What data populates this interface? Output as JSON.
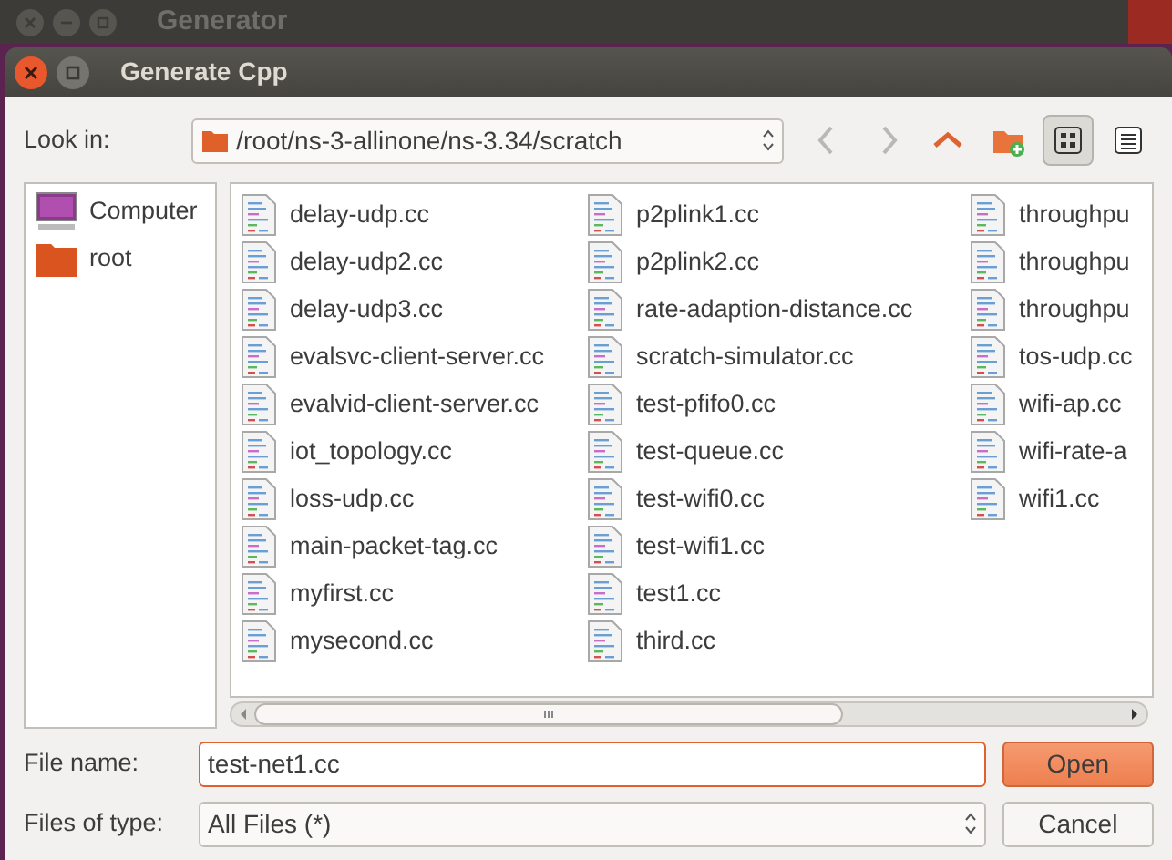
{
  "background_window": {
    "title": "Generator"
  },
  "dialog": {
    "title": "Generate Cpp"
  },
  "look_in": {
    "label": "Look in:",
    "path": "/root/ns-3-allinone/ns-3.34/scratch"
  },
  "toolbar": [
    {
      "kind": "back",
      "disabled": true
    },
    {
      "kind": "forward",
      "disabled": true
    },
    {
      "kind": "up",
      "disabled": false
    },
    {
      "kind": "new-folder",
      "disabled": false
    },
    {
      "kind": "icon-view",
      "selected": true
    },
    {
      "kind": "detail-view",
      "selected": false
    }
  ],
  "places": [
    {
      "kind": "computer",
      "label": "Computer"
    },
    {
      "kind": "folder",
      "label": "root"
    }
  ],
  "file_columns": [
    [
      "delay-udp.cc",
      "delay-udp2.cc",
      "delay-udp3.cc",
      "evalsvc-client-server.cc",
      "evalvid-client-server.cc",
      "iot_topology.cc",
      "loss-udp.cc",
      "main-packet-tag.cc",
      "myfirst.cc",
      "mysecond.cc"
    ],
    [
      "p2plink1.cc",
      "p2plink2.cc",
      "rate-adaption-distance.cc",
      "scratch-simulator.cc",
      "test-pfifo0.cc",
      "test-queue.cc",
      "test-wifi0.cc",
      "test-wifi1.cc",
      "test1.cc",
      "third.cc"
    ],
    [
      "throughpu",
      "throughpu",
      "throughpu",
      "tos-udp.cc",
      "wifi-ap.cc",
      "wifi-rate-a",
      "wifi1.cc"
    ]
  ],
  "file_name": {
    "label": "File name:",
    "value": "test-net1.cc"
  },
  "files_of_type": {
    "label": "Files of type:",
    "value": "All Files (*)"
  },
  "buttons": [
    {
      "kind": "primary",
      "label": "Open"
    },
    {
      "kind": "secondary",
      "label": "Cancel"
    }
  ]
}
